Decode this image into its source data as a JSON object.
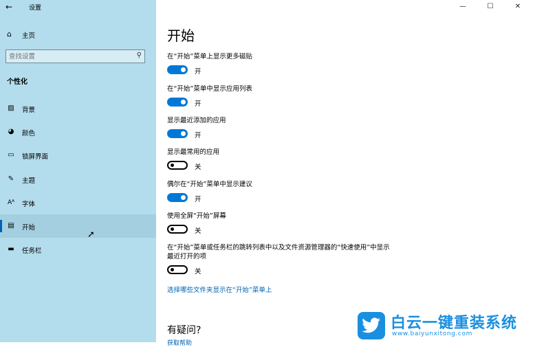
{
  "window": {
    "title": "设置",
    "controls": {
      "minimize": "—",
      "maximize": "☐",
      "close": "✕"
    }
  },
  "sidebar": {
    "home_label": "主页",
    "search_placeholder": "查找设置",
    "section_heading": "个性化",
    "items": [
      {
        "label": "背景",
        "icon": "picture-icon",
        "glyph": "▨"
      },
      {
        "label": "颜色",
        "icon": "palette-icon",
        "glyph": "◕"
      },
      {
        "label": "锁屏界面",
        "icon": "lockscreen-icon",
        "glyph": "▭"
      },
      {
        "label": "主题",
        "icon": "theme-icon",
        "glyph": "✎"
      },
      {
        "label": "字体",
        "icon": "font-icon",
        "glyph": "Aᴬ"
      },
      {
        "label": "开始",
        "icon": "start-icon",
        "glyph": "▤",
        "selected": true
      },
      {
        "label": "任务栏",
        "icon": "taskbar-icon",
        "glyph": "▬"
      }
    ]
  },
  "main": {
    "title": "开始",
    "settings": [
      {
        "label": "在“开始”菜单上显示更多磁贴",
        "state": "开",
        "on": true
      },
      {
        "label": "在“开始”菜单中显示应用列表",
        "state": "开",
        "on": true
      },
      {
        "label": "显示最近添加的应用",
        "state": "开",
        "on": true
      },
      {
        "label": "显示最常用的应用",
        "state": "关",
        "on": false
      },
      {
        "label": "偶尔在“开始”菜单中显示建议",
        "state": "开",
        "on": true
      },
      {
        "label": "使用全屏“开始”屏幕",
        "state": "关",
        "on": false
      },
      {
        "label": "在“开始”菜单或任务栏的跳转列表中以及文件资源管理器的“快速使用”中显示最近打开的项",
        "state": "关",
        "on": false
      }
    ],
    "folders_link": "选择哪些文件夹显示在“开始”菜单上",
    "question_heading": "有疑问?",
    "get_help": "获取帮助"
  },
  "watermark": {
    "title": "白云一键重装系统",
    "url": "www.baiyunxitong.com"
  },
  "colors": {
    "accent": "#0078d7",
    "sidebar_bg": "#b3dcec",
    "link": "#0063b1"
  }
}
